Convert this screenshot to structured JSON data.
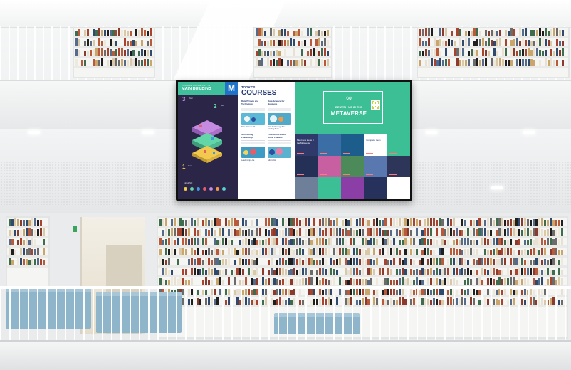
{
  "screen": {
    "map": {
      "subtitle": "YOU ARE CURRENTLY IN",
      "title": "MAIN BUILDING",
      "badge": "M",
      "floors": [
        {
          "number": "3",
          "label": "floor",
          "color": "#c58be0"
        },
        {
          "number": "2",
          "label": "floor",
          "color": "#63d6a8"
        },
        {
          "number": "1",
          "label": "floor",
          "color": "#f2c94c"
        }
      ],
      "legend_label": "LEGEND",
      "legend_colors": [
        "#f2c94c",
        "#63d6a8",
        "#3b9de0",
        "#e35d6a",
        "#c58be0",
        "#f2994a",
        "#5bd3d6"
      ]
    },
    "courses": {
      "kicker": "TODAY'S",
      "title": "COURSES",
      "items": [
        {
          "title": "Data Privacy and Technology",
          "link": "Data Science Bit"
        },
        {
          "title": "Data Science for Business",
          "link": "Data Technology Now Starting Soon"
        },
        {
          "title": "Storytelling Leadership Foundational Principles",
          "link": "Leadership Live"
        },
        {
          "title": "Practitioners Must Know Leaders Chosen: Lessons of 2020",
          "link": "Add to list"
        }
      ]
    },
    "metaverse": {
      "symbol": "∞",
      "line1": "BE WITH US IN THE",
      "line2": "METAVERSE"
    },
    "tiles": [
      {
        "bg": "#2f3a6b",
        "text": "Meet new ideas in the Metaverse"
      },
      {
        "bg": "#3a6ea5",
        "text": ""
      },
      {
        "bg": "#1d5d8c",
        "text": ""
      },
      {
        "bg": "#ffffff",
        "text": "Complete them"
      },
      {
        "bg": "#3cbf95",
        "text": ""
      },
      {
        "bg": "#243056",
        "text": ""
      },
      {
        "bg": "#c85fa0",
        "text": ""
      },
      {
        "bg": "#4d8a5a",
        "text": ""
      },
      {
        "bg": "#5a78b0",
        "text": ""
      },
      {
        "bg": "#2d3558",
        "text": ""
      },
      {
        "bg": "#6e7f99",
        "text": ""
      },
      {
        "bg": "#3cbf95",
        "text": ""
      },
      {
        "bg": "#8b3fa6",
        "text": ""
      },
      {
        "bg": "#26315c",
        "text": ""
      },
      {
        "bg": "#ffffff",
        "text": ""
      }
    ]
  }
}
